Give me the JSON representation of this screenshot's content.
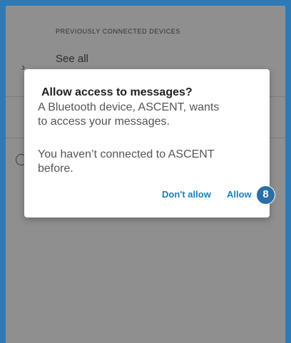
{
  "background_page": {
    "section_header": "PREVIOUSLY CONNECTED DEVICES",
    "see_all": {
      "title": "See all",
      "subtitle": ""
    }
  },
  "dialog": {
    "title": "Allow access to messages?",
    "body_1": "A Bluetooth device, ASCENT, wants\nto access your messages.",
    "body_2": "You haven’t connected to ASCENT\nbefore.",
    "buttons": {
      "deny_label": "Don't allow",
      "allow_label": "Allow"
    }
  },
  "annotation": {
    "step_number": "8"
  },
  "colors": {
    "frame_border": "#2e7ab6",
    "scrim": "#8f8f8f",
    "accent_button": "#1a7fc0",
    "badge": "#2a6fa8"
  }
}
